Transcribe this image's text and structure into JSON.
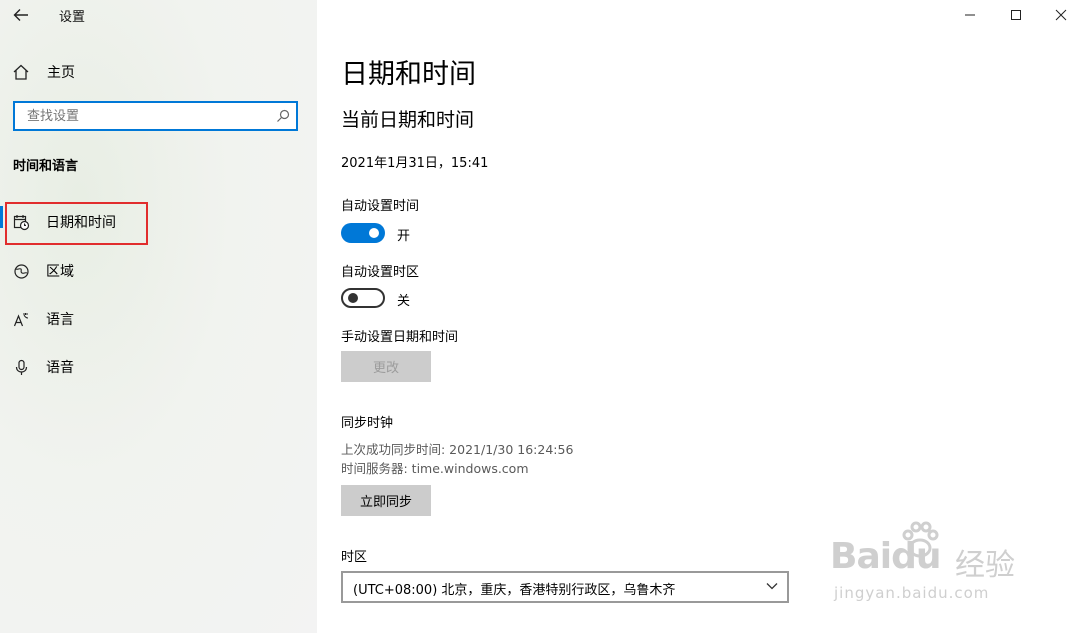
{
  "window": {
    "title": "设置",
    "controls": {
      "minimize": "minimize-icon",
      "maximize": "maximize-icon",
      "close": "close-icon"
    }
  },
  "sidebar": {
    "home_label": "主页",
    "search_placeholder": "查找设置",
    "section_title": "时间和语言",
    "items": [
      {
        "label": "日期和时间",
        "icon": "calendar-clock-icon",
        "selected": true
      },
      {
        "label": "区域",
        "icon": "globe-icon",
        "selected": false
      },
      {
        "label": "语言",
        "icon": "language-icon",
        "selected": false
      },
      {
        "label": "语音",
        "icon": "microphone-icon",
        "selected": false
      }
    ]
  },
  "main": {
    "page_title": "日期和时间",
    "current_section_title": "当前日期和时间",
    "current_datetime": "2021年1月31日，15:41",
    "auto_time": {
      "label": "自动设置时间",
      "state": "开",
      "on": true
    },
    "auto_timezone": {
      "label": "自动设置时区",
      "state": "关",
      "on": false
    },
    "manual": {
      "label": "手动设置日期和时间",
      "button": "更改"
    },
    "sync": {
      "title": "同步时钟",
      "last_sync": "上次成功同步时间: 2021/1/30 16:24:56",
      "server": "时间服务器: time.windows.com",
      "button": "立即同步"
    },
    "timezone": {
      "label": "时区",
      "selected": "(UTC+08:00) 北京，重庆，香港特别行政区，乌鲁木齐"
    }
  },
  "colors": {
    "accent": "#0078d7",
    "highlight_box": "#e12d2d"
  },
  "watermark": {
    "brand": "Baidu",
    "brand_suffix": "经验",
    "url": "jingyan.baidu.com"
  }
}
